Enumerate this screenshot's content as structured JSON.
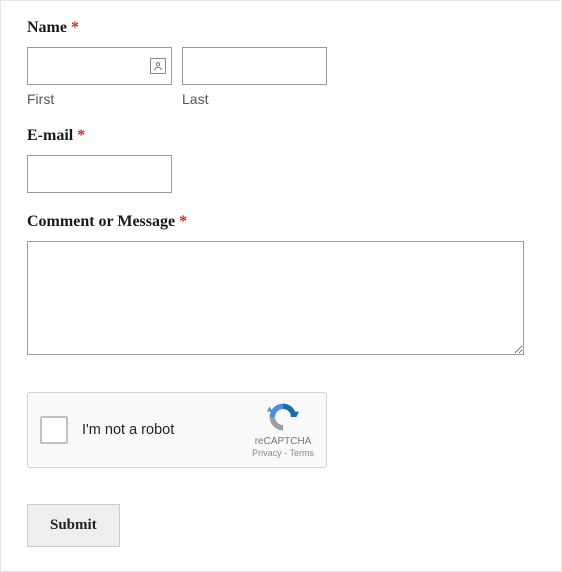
{
  "name": {
    "label": "Name",
    "required": "*",
    "first_sub": "First",
    "last_sub": "Last",
    "first_value": "",
    "last_value": ""
  },
  "email": {
    "label": "E-mail",
    "required": "*",
    "value": ""
  },
  "message": {
    "label": "Comment or Message",
    "required": "*",
    "value": ""
  },
  "recaptcha": {
    "label": "I'm not a robot",
    "brand": "reCAPTCHA",
    "privacy": "Privacy",
    "terms": "Terms",
    "sep": " - "
  },
  "submit": {
    "label": "Submit"
  }
}
